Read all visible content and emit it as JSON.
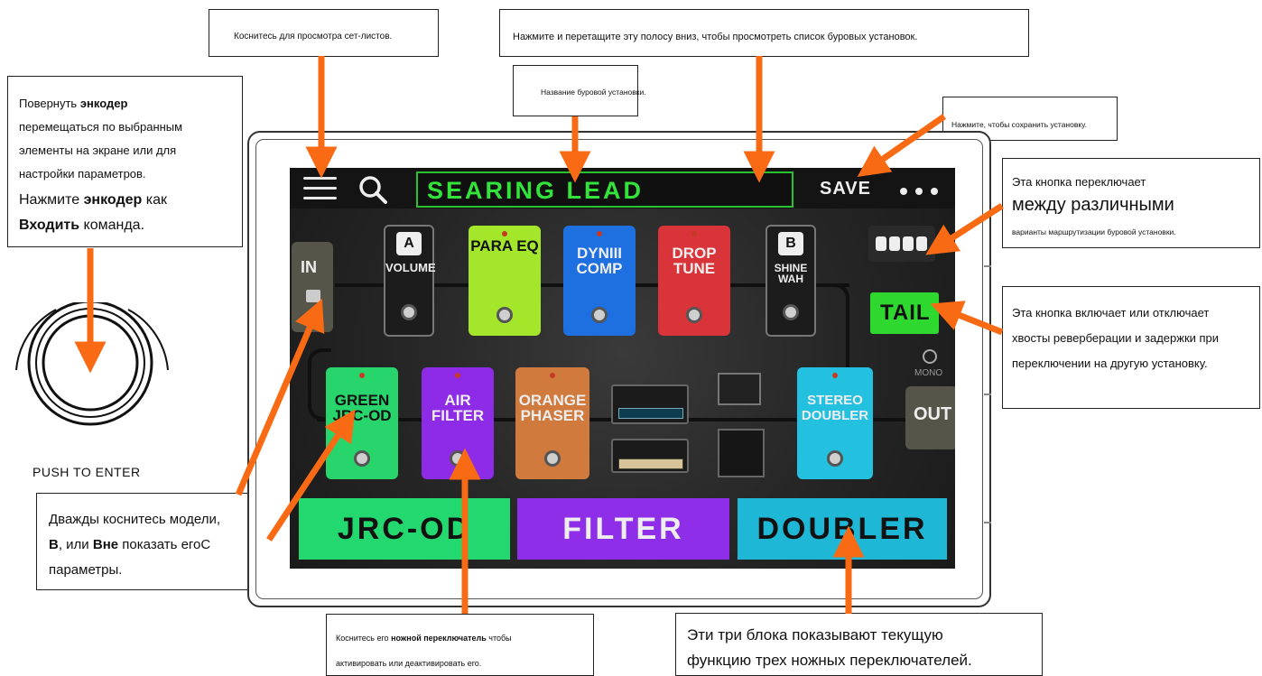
{
  "screen": {
    "patch_name": "SEARING LEAD",
    "save_label": "SAVE",
    "input_label": "IN",
    "output_label": "OUT",
    "tail_label": "TAIL",
    "mono_label": "MONO",
    "row1": [
      {
        "label": "VOLUME",
        "badge": "A",
        "style": "dark"
      },
      {
        "label": "PARA EQ",
        "color": "#a4e62a"
      },
      {
        "label": "DYNIII\nCOMP",
        "color": "#1e6fe0"
      },
      {
        "label": "DROP\nTUNE",
        "color": "#d9343a"
      },
      {
        "label": "SHINE\nWAH",
        "badge": "B",
        "style": "dark"
      }
    ],
    "row2": [
      {
        "label": "GREEN\nJRC-OD",
        "color": "#27d56c"
      },
      {
        "label": "AIR\nFILTER",
        "color": "#8d2be6"
      },
      {
        "label": "ORANGE\nPHASER",
        "color": "#d07a3e"
      },
      {
        "label": "STEREO\nDOUBLER",
        "color": "#23c0e0"
      }
    ],
    "footswitch_blocks": [
      {
        "label": "JRC-OD",
        "color": "#22d86f"
      },
      {
        "label": "FILTER",
        "color": "#8f2ee8"
      },
      {
        "label": "DOUBLER",
        "color": "#1fb7d6"
      }
    ]
  },
  "callouts": {
    "setlists": "Коснитесь для просмотра сет-листов.",
    "drag_down": "Нажмите и перетащите эту полосу вниз, чтобы просмотреть список буровых установок.",
    "preset_name": "Название буровой установки.",
    "save": "Нажмите, чтобы сохранить установку.",
    "encoder": {
      "l1": "Повернуть",
      "l1b": "энкодер",
      "l2": "перемещаться по выбранным",
      "l3": "элементы на экране или для",
      "l4": "настройки параметров.",
      "l5": "Нажмите",
      "l5b": "энкодер",
      "l5c": "как",
      "l6b": "Входить",
      "l6": "команда."
    },
    "routing": {
      "l1": "Эта кнопка переключает",
      "l2": "между различными",
      "l3": "варианты маршрутизации буровой установки."
    },
    "tail": {
      "l1": "Эта кнопка включает или отключает",
      "l2": "хвосты реверберации и задержки при",
      "l3": "переключении на другую установку."
    },
    "model": {
      "l1": "Дважды коснитесь модели,",
      "b1": "В",
      "t1": ", или",
      "b2": "Вне",
      "t2": "показать его",
      "t2b": "С",
      "l3": "параметры."
    },
    "footswitch": {
      "l1a": "Коснитесь его",
      "l1b": "ножной переключатель",
      "l1c": "чтобы",
      "l2": "активировать или деактивировать его."
    },
    "blocks": {
      "l1": "Эти три блока показывают текущую",
      "l2": "функцию трех ножных переключателей."
    }
  },
  "push_to_enter": "PUSH TO ENTER",
  "colors": {
    "arrow": "#f96a14",
    "patch_name": "#33e23a",
    "tail": "#2fd82f"
  }
}
